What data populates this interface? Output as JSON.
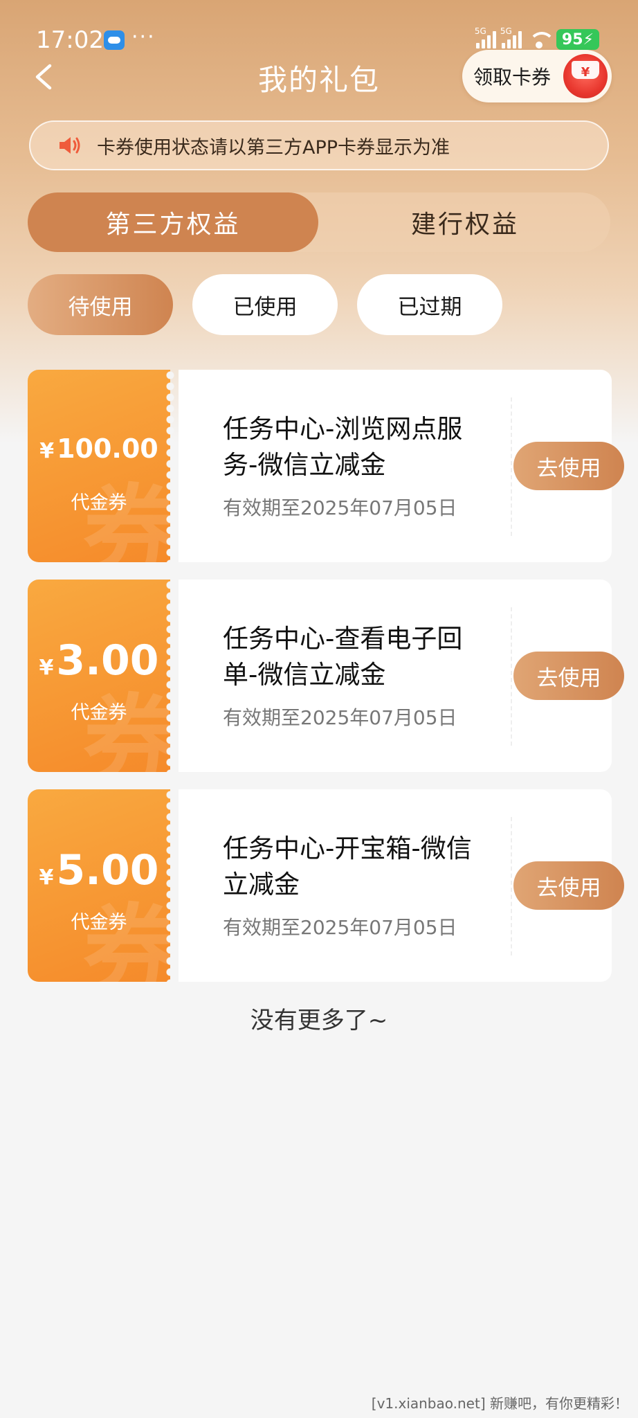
{
  "status_bar": {
    "time": "17:02",
    "signal_1_label": "5G",
    "signal_2_label": "5G",
    "battery": "95"
  },
  "header": {
    "title": "我的礼包",
    "get_coupon_label": "领取卡券",
    "gift_symbol": "¥"
  },
  "notice": {
    "text": "卡券使用状态请以第三方APP卡券显示为准"
  },
  "tabs": [
    {
      "label": "第三方权益",
      "active": true
    },
    {
      "label": "建行权益",
      "active": false
    }
  ],
  "filters": [
    {
      "label": "待使用",
      "active": true
    },
    {
      "label": "已使用",
      "active": false
    },
    {
      "label": "已过期",
      "active": false
    }
  ],
  "coupons": [
    {
      "currency": "¥",
      "amount": "100.00",
      "type": "代金券",
      "title": "任务中心-浏览网点服务-微信立减金",
      "expiry": "有效期至2025年07月05日",
      "button": "去使用",
      "watermark_char": "券"
    },
    {
      "currency": "¥",
      "amount": "3.00",
      "type": "代金券",
      "title": "任务中心-查看电子回单-微信立减金",
      "expiry": "有效期至2025年07月05日",
      "button": "去使用",
      "watermark_char": "券"
    },
    {
      "currency": "¥",
      "amount": "5.00",
      "type": "代金券",
      "title": "任务中心-开宝箱-微信立减金",
      "expiry": "有效期至2025年07月05日",
      "button": "去使用",
      "watermark_char": "券"
    }
  ],
  "footer": {
    "no_more": "没有更多了~"
  },
  "watermark": "[v1.xianbao.net] 新赚吧，有你更精彩！",
  "colors": {
    "accent": "#cf8450",
    "coupon_orange": "#f58a2a",
    "battery_green": "#35c759"
  }
}
